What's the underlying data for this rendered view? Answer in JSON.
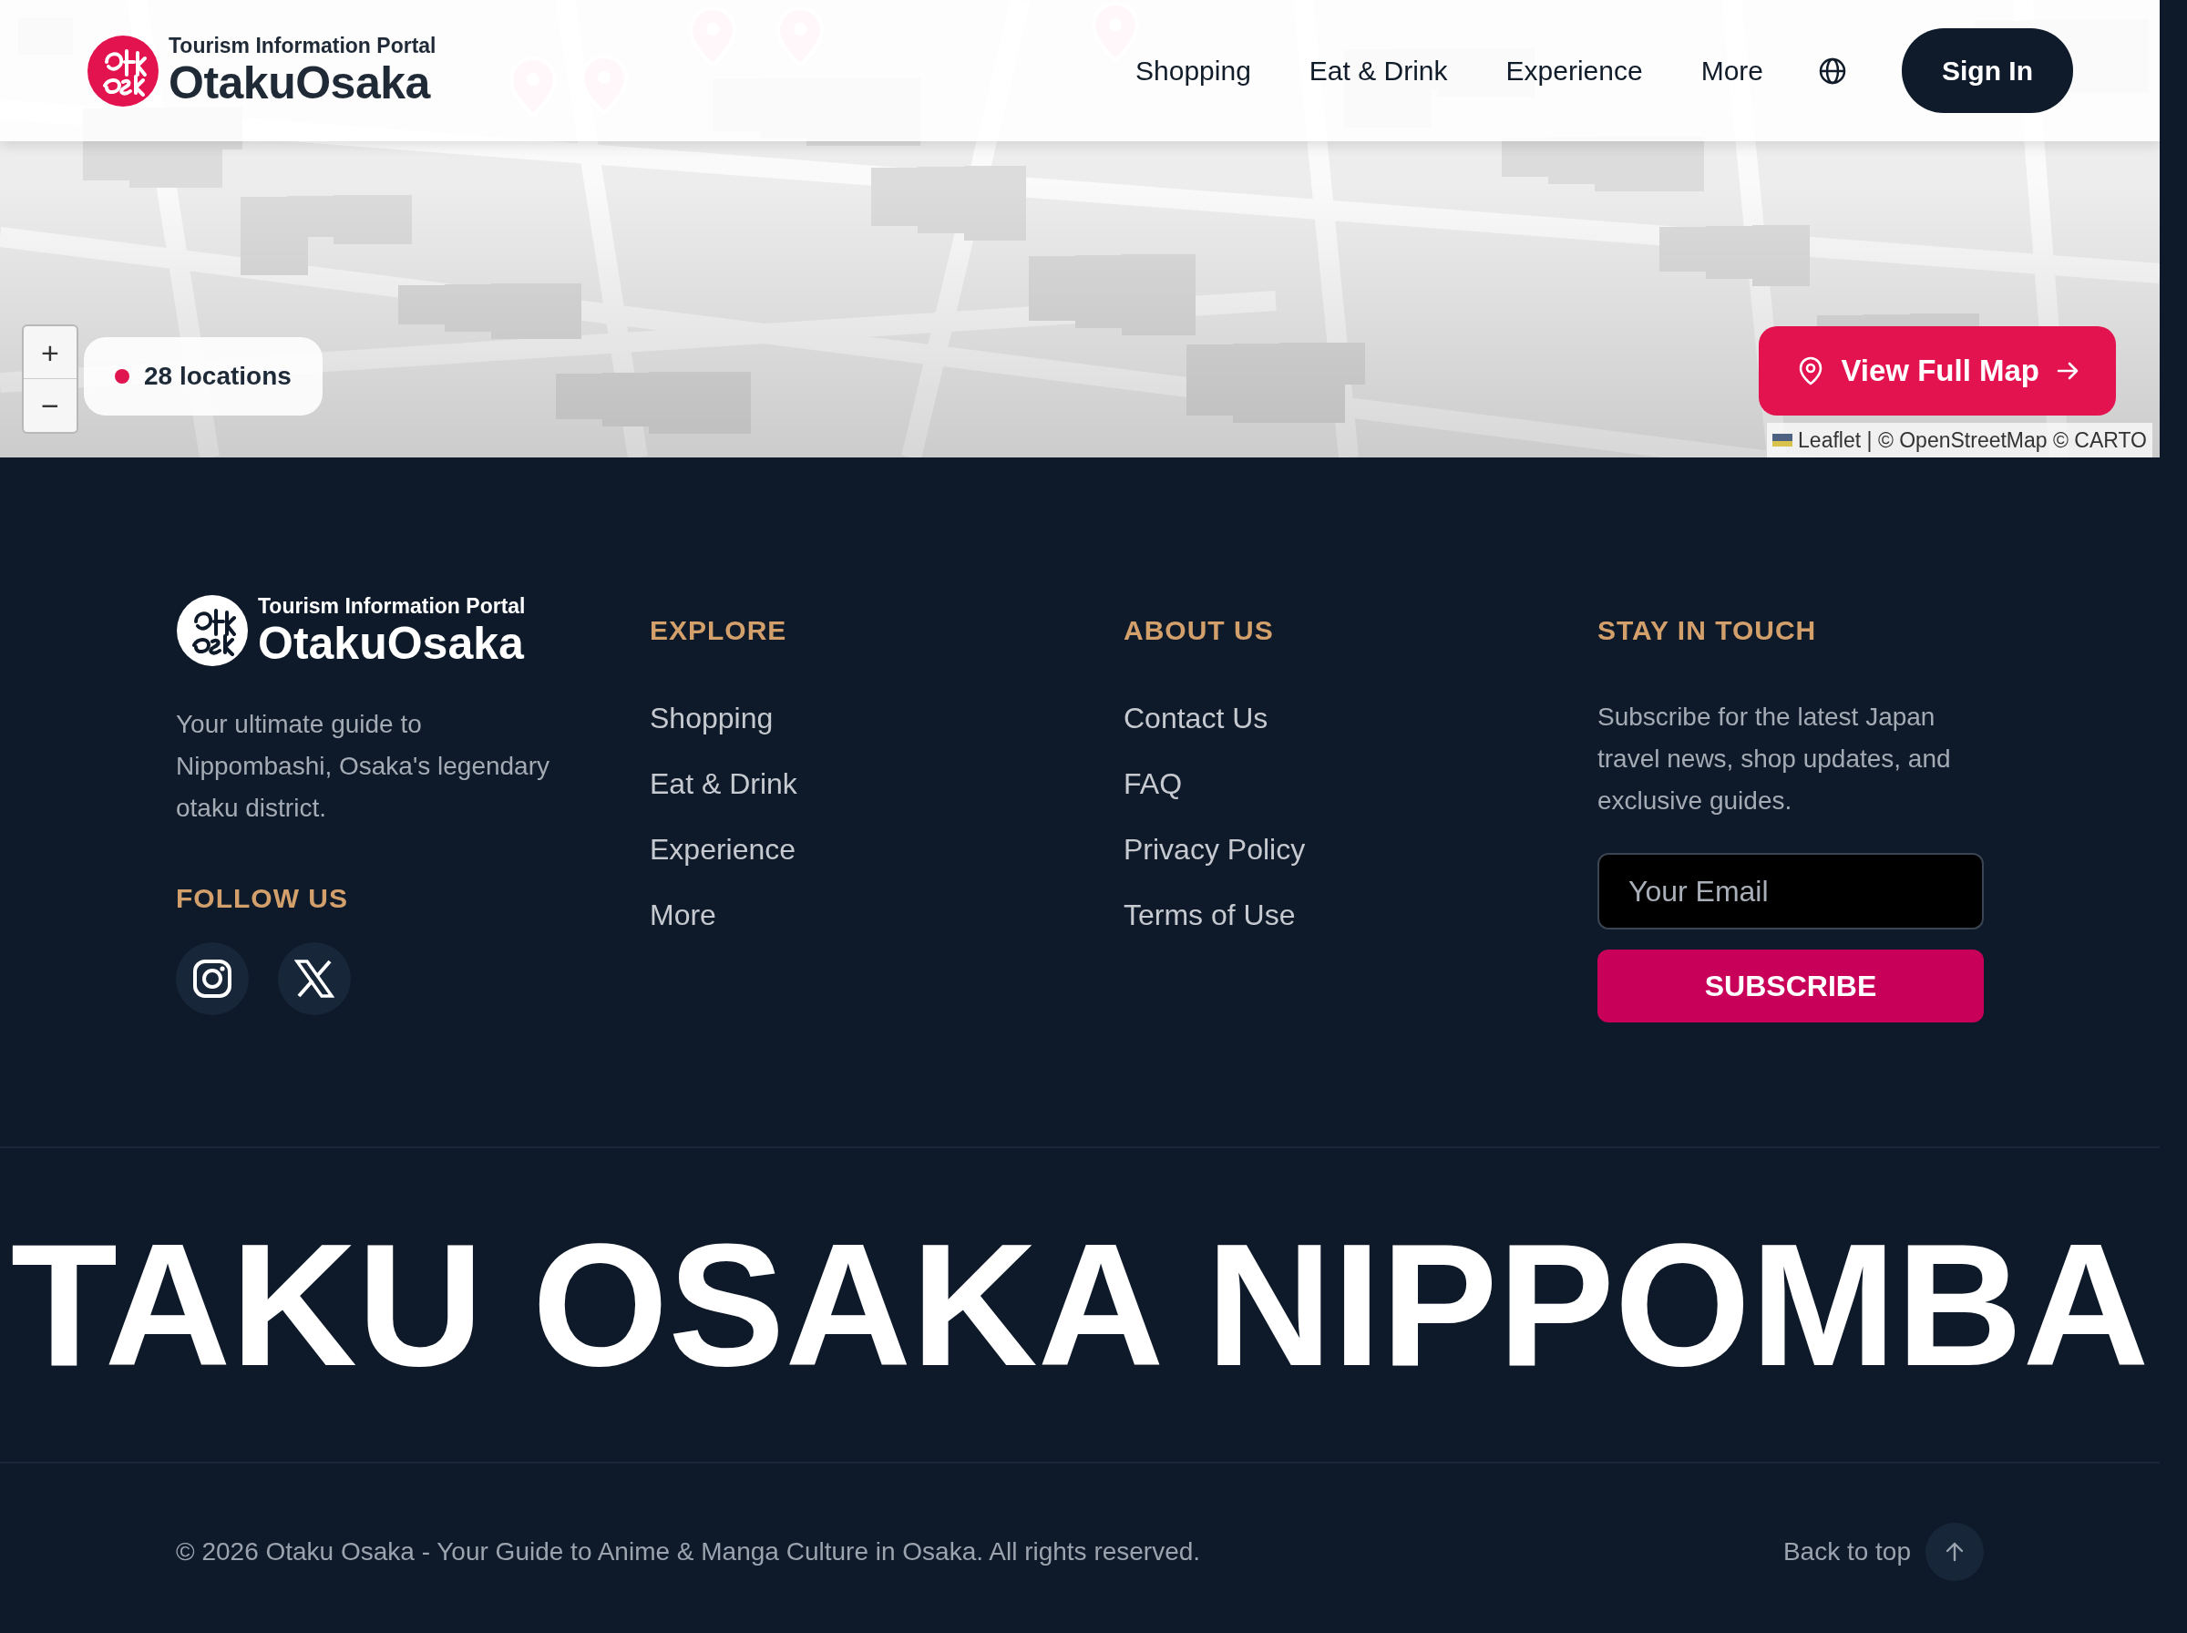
{
  "header": {
    "logo": {
      "tagline": "Tourism Information Portal",
      "name": "OtakuOsaka"
    },
    "nav": [
      "Shopping",
      "Eat & Drink",
      "Experience",
      "More"
    ],
    "sign_in": "Sign In"
  },
  "map": {
    "zoom_controls": [
      "+",
      "−"
    ],
    "locations_badge": "28 locations",
    "view_full_map": "View Full Map",
    "attribution": "Leaflet | © OpenStreetMap © CARTO"
  },
  "footer": {
    "logo": {
      "tagline": "Tourism Information Portal",
      "name": "OtakuOsaka"
    },
    "description": "Your ultimate guide to Nippombashi, Osaka's legendary otaku district.",
    "follow_heading": "FOLLOW US",
    "social": [
      {
        "kind": "instagram"
      },
      {
        "kind": "x"
      }
    ],
    "columns": [
      {
        "heading": "EXPLORE",
        "links": [
          "Shopping",
          "Eat & Drink",
          "Experience",
          "More"
        ]
      },
      {
        "heading": "ABOUT US",
        "links": [
          "Contact Us",
          "FAQ",
          "Privacy Policy",
          "Terms of Use"
        ]
      }
    ],
    "newsletter": {
      "heading": "STAY IN TOUCH",
      "text": "Subscribe for the latest Japan travel news, shop updates, and exclusive guides.",
      "placeholder": "Your Email",
      "button": "SUBSCRIBE"
    },
    "marquee": "TAKU OSAKA NIPPOMBA",
    "copyright": "© 2026 Otaku Osaka - Your Guide to Anime & Manga Culture in Osaka. All rights reserved.",
    "back_to_top": "Back to top"
  }
}
